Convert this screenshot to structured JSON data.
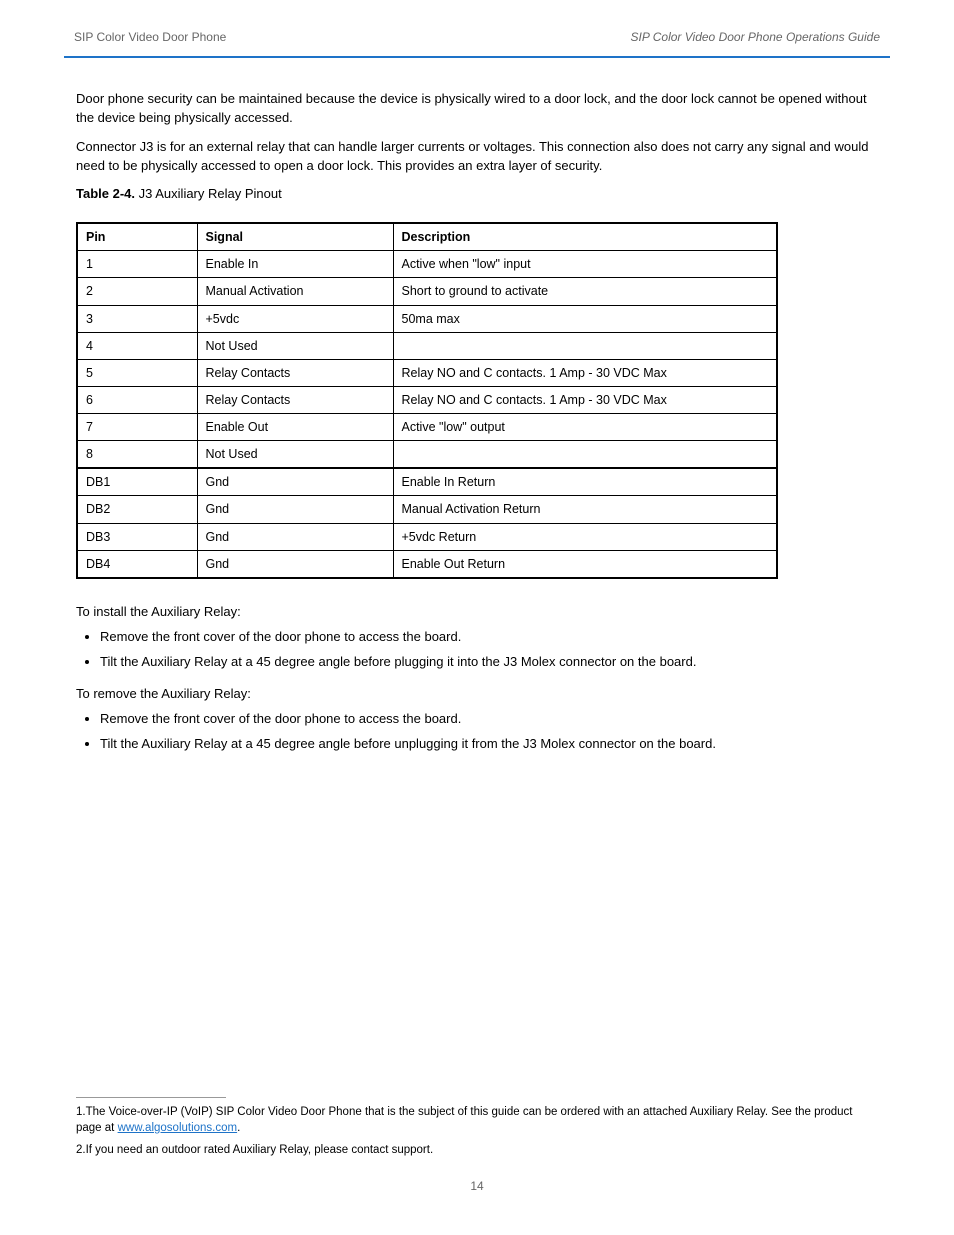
{
  "header": {
    "product": "SIP Color Video Door Phone",
    "chapter": "SIP Color Video Door Phone Operations Guide"
  },
  "intro": {
    "p1": "Door phone security can be maintained because the device is physically wired to a door lock, and the door lock cannot be opened without the device being physically accessed.",
    "p2": "Connector J3 is for an external relay that can handle larger currents or voltages. This connection also does not carry any signal and would need to be physically accessed to open a door lock. This provides an extra layer of security."
  },
  "table": {
    "caption_label": "Table 2-4.",
    "caption_text": "J3 Auxiliary Relay Pinout",
    "headers": [
      "Pin",
      "Signal",
      "Description"
    ],
    "rows": [
      [
        "1",
        "Enable In",
        "Active when \"low\" input"
      ],
      [
        "2",
        "Manual Activation",
        "Short to ground to activate"
      ],
      [
        "3",
        "+5vdc",
        "50ma max"
      ],
      [
        "4",
        "Not Used",
        ""
      ],
      [
        "5",
        "Relay Contacts",
        "Relay NO and C contacts. 1 Amp - 30 VDC Max"
      ],
      [
        "6",
        "Relay Contacts",
        "Relay NO and C contacts. 1 Amp - 30 VDC Max"
      ],
      [
        "7",
        "Enable Out",
        "Active \"low\" output"
      ],
      [
        "8",
        "Not Used",
        ""
      ],
      [
        "DB1",
        "Gnd",
        "Enable In Return"
      ],
      [
        "DB2",
        "Gnd",
        "Manual Activation Return"
      ],
      [
        "DB3",
        "Gnd",
        "+5vdc Return"
      ],
      [
        "DB4",
        "Gnd",
        "Enable Out Return"
      ]
    ],
    "heavy_before": [
      8,
      12
    ]
  },
  "instructions": {
    "install_lead": "To install the Auxiliary Relay:",
    "install_items": [
      "Remove the front cover of the door phone to access the board.",
      "Tilt the Auxiliary Relay at a 45 degree angle before plugging it into the J3 Molex connector on the board."
    ],
    "remove_lead": "To remove the Auxiliary Relay:",
    "remove_items": [
      "Remove the front cover of the door phone to access the board.",
      "Tilt the Auxiliary Relay at a 45 degree angle before unplugging it from the J3 Molex connector on the board."
    ]
  },
  "footnotes": {
    "f1_pre": "1.The Voice-over-IP (VoIP) SIP Color Video Door Phone that is the subject of this guide can be ordered with an attached Auxiliary Relay. See the product page at",
    "f1_link": "www.algosolutions.com",
    "f1_post": ".",
    "f2": "2.If you need an outdoor rated Auxiliary Relay, please contact support."
  },
  "footer": {
    "page": "14"
  }
}
